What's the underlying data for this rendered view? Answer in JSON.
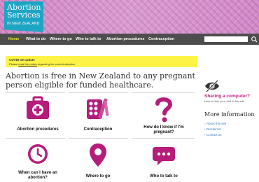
{
  "logo": {
    "line1": "Abortion",
    "line2": "Services",
    "line3": "IN NEW ZEALAND"
  },
  "nav": {
    "items": [
      "Home",
      "What to do",
      "Where to go",
      "Who to talk to",
      "Abortion procedures",
      "Contraception"
    ],
    "search_placeholder": ""
  },
  "covid": {
    "title": "COVID-19 update",
    "text_before": "Please ",
    "link": "read the notice",
    "text_after": " regarding the current situation"
  },
  "headline": "Abortion is free in New Zealand to any pregnant person eligible for funded healthcare.",
  "tiles": [
    {
      "label": "Abortion procedures",
      "icon": "medical-kit-icon"
    },
    {
      "label": "Contraception",
      "icon": "pill-pack-icon"
    },
    {
      "label": "How do I know if I'm pregnant?",
      "icon": "question-mark-icon"
    },
    {
      "label": "When can I have an abortion?",
      "icon": "clock-icon"
    },
    {
      "label": "Where to go",
      "icon": "map-pin-icon"
    },
    {
      "label": "Who to talk to",
      "icon": "speech-bubble-icon"
    }
  ],
  "sidebar": {
    "sharing_title": "Sharing a computer?",
    "sharing_sub": "How to hide your visit to this site",
    "more_title": "More information",
    "links": [
      "About this site",
      "Disclaimer",
      "Contact us"
    ]
  },
  "colors": {
    "accent_magenta": "#c71c80",
    "nav_bg": "#4d4d4d",
    "nav_active": "#e6ed2a",
    "covid_bg": "#fdf347",
    "logo_bg": "#1fa5c4"
  }
}
